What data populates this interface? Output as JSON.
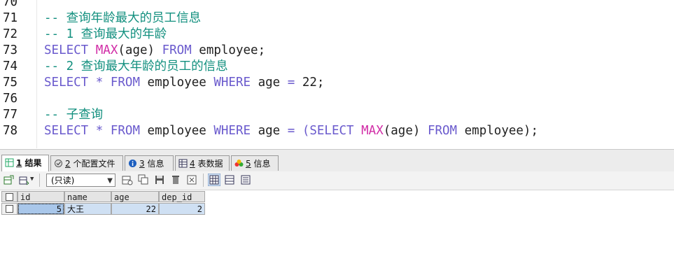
{
  "editor": {
    "lines": [
      {
        "num": "70",
        "parts": []
      },
      {
        "num": "71",
        "parts": [
          {
            "t": "-- 查询年龄最大的员工信息",
            "c": "comment"
          }
        ]
      },
      {
        "num": "72",
        "parts": [
          {
            "t": "-- 1 查询最大的年龄",
            "c": "comment"
          }
        ]
      },
      {
        "num": "73",
        "parts": [
          {
            "t": "SELECT ",
            "c": "kw"
          },
          {
            "t": "MAX",
            "c": "fn"
          },
          {
            "t": "(age) ",
            "c": "id"
          },
          {
            "t": "FROM ",
            "c": "kw"
          },
          {
            "t": "employee;",
            "c": "id"
          }
        ]
      },
      {
        "num": "74",
        "parts": [
          {
            "t": "-- 2 查询最大年龄的员工的信息",
            "c": "comment"
          }
        ]
      },
      {
        "num": "75",
        "parts": [
          {
            "t": "SELECT ",
            "c": "kw"
          },
          {
            "t": "* ",
            "c": "op"
          },
          {
            "t": "FROM ",
            "c": "kw"
          },
          {
            "t": "employee ",
            "c": "id"
          },
          {
            "t": "WHERE ",
            "c": "kw"
          },
          {
            "t": "age ",
            "c": "id"
          },
          {
            "t": "= ",
            "c": "op"
          },
          {
            "t": "22;",
            "c": "num"
          }
        ]
      },
      {
        "num": "76",
        "parts": []
      },
      {
        "num": "77",
        "parts": [
          {
            "t": "-- 子查询",
            "c": "comment"
          }
        ]
      },
      {
        "num": "78",
        "parts": [
          {
            "t": "SELECT ",
            "c": "kw"
          },
          {
            "t": "* ",
            "c": "op"
          },
          {
            "t": "FROM ",
            "c": "kw"
          },
          {
            "t": "employee ",
            "c": "id"
          },
          {
            "t": "WHERE ",
            "c": "kw"
          },
          {
            "t": "age ",
            "c": "id"
          },
          {
            "t": "= ",
            "c": "op"
          },
          {
            "t": "(",
            "c": "op"
          },
          {
            "t": "SELECT ",
            "c": "kw"
          },
          {
            "t": "MAX",
            "c": "fn"
          },
          {
            "t": "(age) ",
            "c": "id"
          },
          {
            "t": "FROM ",
            "c": "kw"
          },
          {
            "t": "employee);",
            "c": "id"
          }
        ]
      }
    ]
  },
  "tabs": [
    {
      "num": "1",
      "label": "结果",
      "icon": "table-result-icon",
      "active": true
    },
    {
      "num": "2",
      "label": "个配置文件",
      "icon": "profile-icon",
      "active": false
    },
    {
      "num": "3",
      "label": "信息",
      "icon": "info-icon",
      "active": false
    },
    {
      "num": "4",
      "label": "表数据",
      "icon": "table-data-icon",
      "active": false
    },
    {
      "num": "5",
      "label": "信息",
      "icon": "history-icon",
      "active": false
    }
  ],
  "toolbar": {
    "mode_select": "(只读)"
  },
  "grid": {
    "columns": [
      "id",
      "name",
      "age",
      "dep_id"
    ],
    "rows": [
      {
        "id": "5",
        "name": "大王",
        "age": "22",
        "dep_id": "2"
      }
    ]
  },
  "colors": {
    "comment": "#13907f",
    "keyword": "#6a5acd",
    "function": "#d12ca6",
    "row_selected": "#cfe0f3"
  }
}
